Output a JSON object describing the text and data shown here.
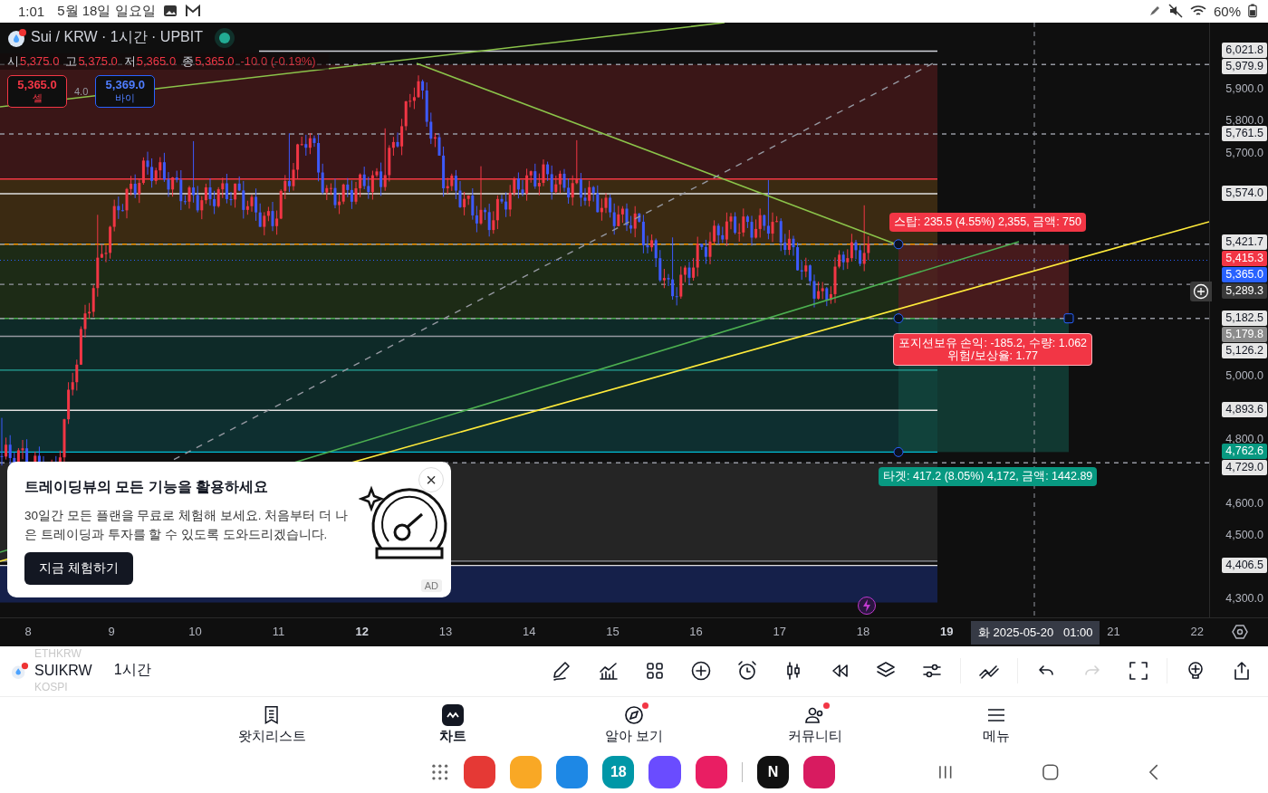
{
  "status_bar": {
    "time": "1:01",
    "date": "5월 18일 일요일",
    "battery": "60%"
  },
  "chart": {
    "symbol_title": "Sui / KRW · 1시간 · UPBIT",
    "market_open": true,
    "ohlc": [
      {
        "label": "시",
        "value": "5,375.0"
      },
      {
        "label": "고",
        "value": "5,375.0"
      },
      {
        "label": "저",
        "value": "5,365.0"
      },
      {
        "label": "종",
        "value": "5,365.0"
      }
    ],
    "change": "-10.0 (-0.19%)",
    "sell": {
      "price": "5,365.0",
      "label": "셀"
    },
    "spread": "4.0",
    "buy": {
      "price": "5,369.0",
      "label": "바이"
    },
    "price_axis": [
      {
        "text": "6,021.8",
        "kind": "marker",
        "color": "#e6e6e6"
      },
      {
        "text": "5,979.9",
        "kind": "marker",
        "color": "#e6e6e6"
      },
      {
        "text": "5,900.0",
        "kind": "tick"
      },
      {
        "text": "5,800.0",
        "kind": "tick"
      },
      {
        "text": "5,761.5",
        "kind": "marker",
        "color": "#e6e6e6"
      },
      {
        "text": "5,700.0",
        "kind": "tick"
      },
      {
        "text": "5,574.0",
        "kind": "marker",
        "color": "#e6e6e6"
      },
      {
        "text": "5,421.7",
        "kind": "marker",
        "color": "#e6e6e6"
      },
      {
        "text": "5,415.3",
        "kind": "marker",
        "color": "#f23645"
      },
      {
        "text": "5,365.0",
        "kind": "marker",
        "color": "#2962ff"
      },
      {
        "text": "5,289.3",
        "kind": "crosshair",
        "color": "#3a3a3a"
      },
      {
        "text": "5,182.5",
        "kind": "marker",
        "color": "#e6e6e6"
      },
      {
        "text": "5,179.8",
        "kind": "marker",
        "color": "#8c8c8c"
      },
      {
        "text": "5,126.2",
        "kind": "marker",
        "color": "#e6e6e6"
      },
      {
        "text": "5,000.0",
        "kind": "tick"
      },
      {
        "text": "4,893.6",
        "kind": "marker",
        "color": "#e6e6e6"
      },
      {
        "text": "4,800.0",
        "kind": "tick"
      },
      {
        "text": "4,762.6",
        "kind": "marker",
        "color": "#089981"
      },
      {
        "text": "4,729.0",
        "kind": "marker",
        "color": "#e6e6e6"
      },
      {
        "text": "4,600.0",
        "kind": "tick"
      },
      {
        "text": "4,500.0",
        "kind": "tick"
      },
      {
        "text": "4,406.5",
        "kind": "marker",
        "color": "#e6e6e6"
      },
      {
        "text": "4,300.0",
        "kind": "tick"
      }
    ],
    "time_axis": [
      {
        "text": "8",
        "bold": false
      },
      {
        "text": "9",
        "bold": false
      },
      {
        "text": "10",
        "bold": false
      },
      {
        "text": "11",
        "bold": false
      },
      {
        "text": "12",
        "bold": true
      },
      {
        "text": "13",
        "bold": false
      },
      {
        "text": "14",
        "bold": false
      },
      {
        "text": "15",
        "bold": false
      },
      {
        "text": "16",
        "bold": false
      },
      {
        "text": "17",
        "bold": false
      },
      {
        "text": "18",
        "bold": false
      },
      {
        "text": "19",
        "bold": true
      },
      {
        "text": "21",
        "bold": false
      },
      {
        "text": "22",
        "bold": false
      }
    ],
    "crosshair_time": "화 2025-05-20   01:00",
    "position": {
      "stop": "스탑: 235.5 (4.55%) 2,355, 금액: 750",
      "pnl": "포지션보유 손익: -185.2, 수량: 1.062",
      "ratio": "위험/보상율: 1.77",
      "target": "타겟: 417.2 (8.05%) 4,172, 금액: 1442.89"
    }
  },
  "promo": {
    "title": "트레이딩뷰의 모든 기능을 활용하세요",
    "body": "30일간 모든 플랜을 무료로 체험해 보세요. 처음부터 더 나은 트레이딩과 투자를 할 수 있도록 도와드리겠습니다.",
    "button": "지금 체험하기",
    "close": "×",
    "badge": "AD"
  },
  "toolbar": {
    "symbol_above": "ETHKRW",
    "symbol": "SUIKRW",
    "symbol_below": "KOSPI",
    "interval": "1시간",
    "redo_disabled": true
  },
  "nav": [
    {
      "label": "왓치리스트",
      "selected": false,
      "notification": false
    },
    {
      "label": "차트",
      "selected": true,
      "notification": false
    },
    {
      "label": "알아 보기",
      "selected": false,
      "notification": true
    },
    {
      "label": "커뮤니티",
      "selected": false,
      "notification": true
    },
    {
      "label": "메뉴",
      "selected": false,
      "notification": false
    }
  ],
  "dock": [
    {
      "color": "#e53935"
    },
    {
      "color": "#f9a825"
    },
    {
      "color": "#1e88e5"
    },
    {
      "color": "#0097a7",
      "glyph": "18"
    },
    {
      "color": "#6a4cff"
    },
    {
      "color": "#e91e63"
    },
    {
      "color": "#111111",
      "glyph": "N"
    },
    {
      "color": "#d81b60"
    }
  ]
}
